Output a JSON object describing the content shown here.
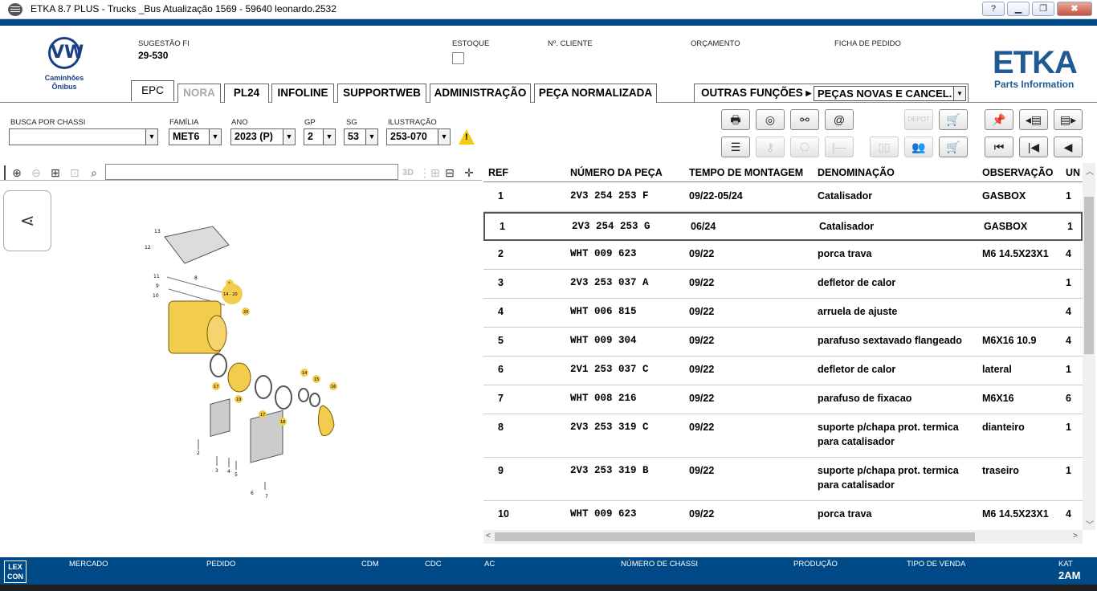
{
  "window": {
    "title": "ETKA 8.7 PLUS - Trucks _Bus Atualização 1569 - 59640 leonardo.2532",
    "buttons": [
      "?",
      "▁",
      "❐",
      "✖"
    ]
  },
  "brand": {
    "vw_logo": "VW",
    "caption_line1": "Caminhões",
    "caption_line2": "Ônibus",
    "etka": "ETKA",
    "etka_sub": "Parts Information"
  },
  "header_fields": {
    "sugestao_label": "SUGESTÃO FI",
    "sugestao_value": "29-530",
    "estoque_label": "ESTOQUE",
    "cliente_label": "Nº. CLIENTE",
    "orcamento_label": "ORÇAMENTO",
    "ficha_label": "FICHA DE PEDIDO"
  },
  "tabs": [
    "EPC",
    "NORA",
    "PL24",
    "INFOLINE",
    "SUPPORTWEB",
    "ADMINISTRAÇÃO",
    "PEÇA NORMALIZADA"
  ],
  "other_functions": {
    "label": "OUTRAS FUNÇÕES ▸",
    "selected": "PEÇAS NOVAS E CANCEL."
  },
  "filters": {
    "chassi_label": "BUSCA POR CHASSI",
    "chassi_value": "",
    "familia_label": "FAMÍLIA",
    "familia_value": "MET6",
    "ano_label": "ANO",
    "ano_value": "2023 (P)",
    "gp_label": "GP",
    "gp_value": "2",
    "sg_label": "SG",
    "sg_value": "53",
    "ilustracao_label": "ILUSTRAÇÃO",
    "ilustracao_value": "253-070"
  },
  "toolbar_icons": [
    "print-icon",
    "parts-search-icon",
    "handshake-icon",
    "email-icon",
    "depot-icon",
    "cart-icon",
    "pin-icon",
    "prev-page-icon",
    "next-page-icon",
    "list-icon",
    "key-icon",
    "network-icon",
    "range-icon",
    "transfer-icon",
    "users-icon",
    "cart-add-icon",
    "first-icon",
    "prev-icon",
    "back-icon"
  ],
  "viewer": {
    "depot_label": "DEPOT",
    "btn_3d": "3D"
  },
  "table": {
    "headers": [
      "REF",
      "NÚMERO DA PEÇA",
      "TEMPO DE MONTAGEM",
      "DENOMINAÇÃO",
      "OBSERVAÇÃO",
      "UN"
    ],
    "rows": [
      {
        "ref": "1",
        "num": "2V3 254 253 F",
        "tempo": "09/22-05/24",
        "den": "Catalisador",
        "den2": "",
        "obs": "GASBOX",
        "un": "1"
      },
      {
        "ref": "1",
        "num": "2V3 254 253 G",
        "tempo": "06/24",
        "den": "Catalisador",
        "den2": "",
        "obs": "GASBOX",
        "un": "1"
      },
      {
        "ref": "2",
        "num": "WHT 009 623",
        "tempo": "09/22",
        "den": "porca trava",
        "den2": "",
        "obs": "M6 14.5X23X1",
        "un": "4"
      },
      {
        "ref": "3",
        "num": "2V3 253 037 A",
        "tempo": "09/22",
        "den": "defletor de calor",
        "den2": "",
        "obs": "",
        "un": "1"
      },
      {
        "ref": "4",
        "num": "WHT 006 815",
        "tempo": "09/22",
        "den": "arruela de ajuste",
        "den2": "",
        "obs": "",
        "un": "4"
      },
      {
        "ref": "5",
        "num": "WHT 009 304",
        "tempo": "09/22",
        "den": "parafuso sextavado flangeado",
        "den2": "",
        "obs": "M6X16 10.9",
        "un": "4"
      },
      {
        "ref": "6",
        "num": "2V1 253 037 C",
        "tempo": "09/22",
        "den": "defletor de calor",
        "den2": "",
        "obs": "lateral",
        "un": "1"
      },
      {
        "ref": "7",
        "num": "WHT 008 216",
        "tempo": "09/22",
        "den": "parafuso de fixacao",
        "den2": "",
        "obs": "M6X16",
        "un": "6"
      },
      {
        "ref": "8",
        "num": "2V3 253 319 C",
        "tempo": "09/22",
        "den": "suporte p/chapa prot. termica",
        "den2": "para catalisador",
        "obs": "dianteiro",
        "un": "1"
      },
      {
        "ref": "9",
        "num": "2V3 253 319 B",
        "tempo": "09/22",
        "den": "suporte p/chapa prot. termica",
        "den2": "para catalisador",
        "obs": "traseiro",
        "un": "1"
      },
      {
        "ref": "10",
        "num": "WHT 009 623",
        "tempo": "09/22",
        "den": "porca trava",
        "den2": "",
        "obs": "M6 14.5X23X1",
        "un": "4"
      }
    ]
  },
  "diagram": {
    "callouts": [
      "13",
      "12",
      "11",
      "9",
      "10",
      "8",
      "1",
      "14 - 20",
      "20",
      "17",
      "19",
      "17",
      "18",
      "14",
      "15",
      "16",
      "2",
      "3",
      "4",
      "5",
      "6",
      "7"
    ]
  },
  "footer": {
    "lexcon": "LEX CON",
    "fields": [
      "MERCADO",
      "PEDIDO",
      "CDM",
      "CDC",
      "AC",
      "NÚMERO DE CHASSI",
      "PRODUÇÃO",
      "TIPO DE VENDA"
    ],
    "kat_label": "KAT",
    "kat_value": "2AM"
  },
  "colors": {
    "accent": "#004b87",
    "logo": "#1f5a94",
    "part_yellow": "#f2cc4d"
  }
}
